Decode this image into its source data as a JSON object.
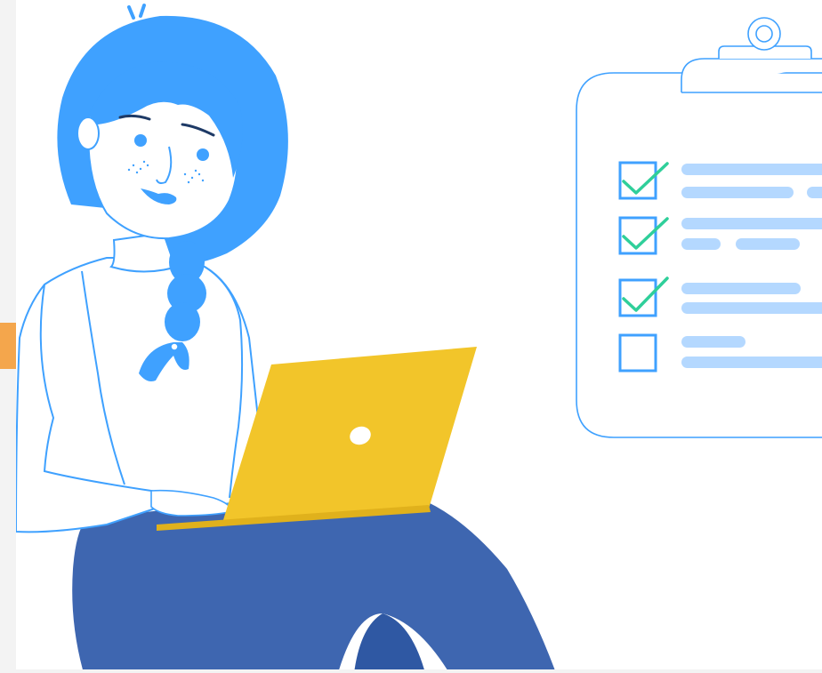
{
  "illustration": {
    "subject": "",
    "checklist": {
      "items": [
        {
          "checked": true
        },
        {
          "checked": true
        },
        {
          "checked": true
        },
        {
          "checked": false
        }
      ]
    }
  },
  "colors": {
    "page_background": "#f3f3f3",
    "canvas_background": "#ffffff",
    "hair": "#3fa1ff",
    "outline": "#3fa1ff",
    "laptop": "#f2c52a",
    "laptop_shadow": "#e0b11c",
    "pants": "#3e66b0",
    "pants_shadow": "#2f58a3",
    "check_box": "#3fa1ff",
    "check_mark": "#2fcf9a",
    "placeholder_line": "#b4d8ff",
    "edge_tab": "#f4a64c"
  }
}
